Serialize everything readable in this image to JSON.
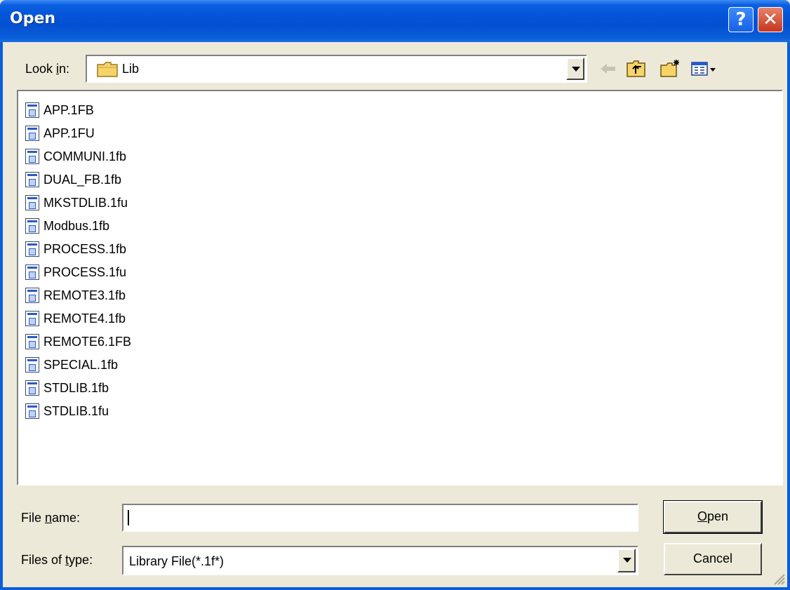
{
  "window": {
    "title": "Open"
  },
  "lookin": {
    "label_pre": "Look ",
    "label_key": "i",
    "label_post": "n:",
    "value": "Lib"
  },
  "files": [
    "APP.1FB",
    "APP.1FU",
    "COMMUNI.1fb",
    "DUAL_FB.1fb",
    "MKSTDLIB.1fu",
    "Modbus.1fb",
    "PROCESS.1fb",
    "PROCESS.1fu",
    "REMOTE3.1fb",
    "REMOTE4.1fb",
    "REMOTE6.1FB",
    "SPECIAL.1fb",
    "STDLIB.1fb",
    "STDLIB.1fu"
  ],
  "filename": {
    "label_pre": "File ",
    "label_key": "n",
    "label_post": "ame:",
    "value": ""
  },
  "filetype": {
    "label_pre": "Files of ",
    "label_key": "t",
    "label_post": "ype:",
    "value": "Library File(*.1f*)"
  },
  "buttons": {
    "open_key": "O",
    "open_rest": "pen",
    "cancel": "Cancel"
  },
  "icons": {
    "help": "help-icon",
    "close": "close-icon",
    "folder": "folder-icon",
    "back": "back-arrow-icon",
    "up": "up-folder-icon",
    "new_folder": "new-folder-icon",
    "view": "view-menu-icon",
    "file": "file-icon"
  },
  "colors": {
    "titlebar": "#0454D8",
    "face": "#ECE9D8",
    "close": "#C4361E"
  }
}
